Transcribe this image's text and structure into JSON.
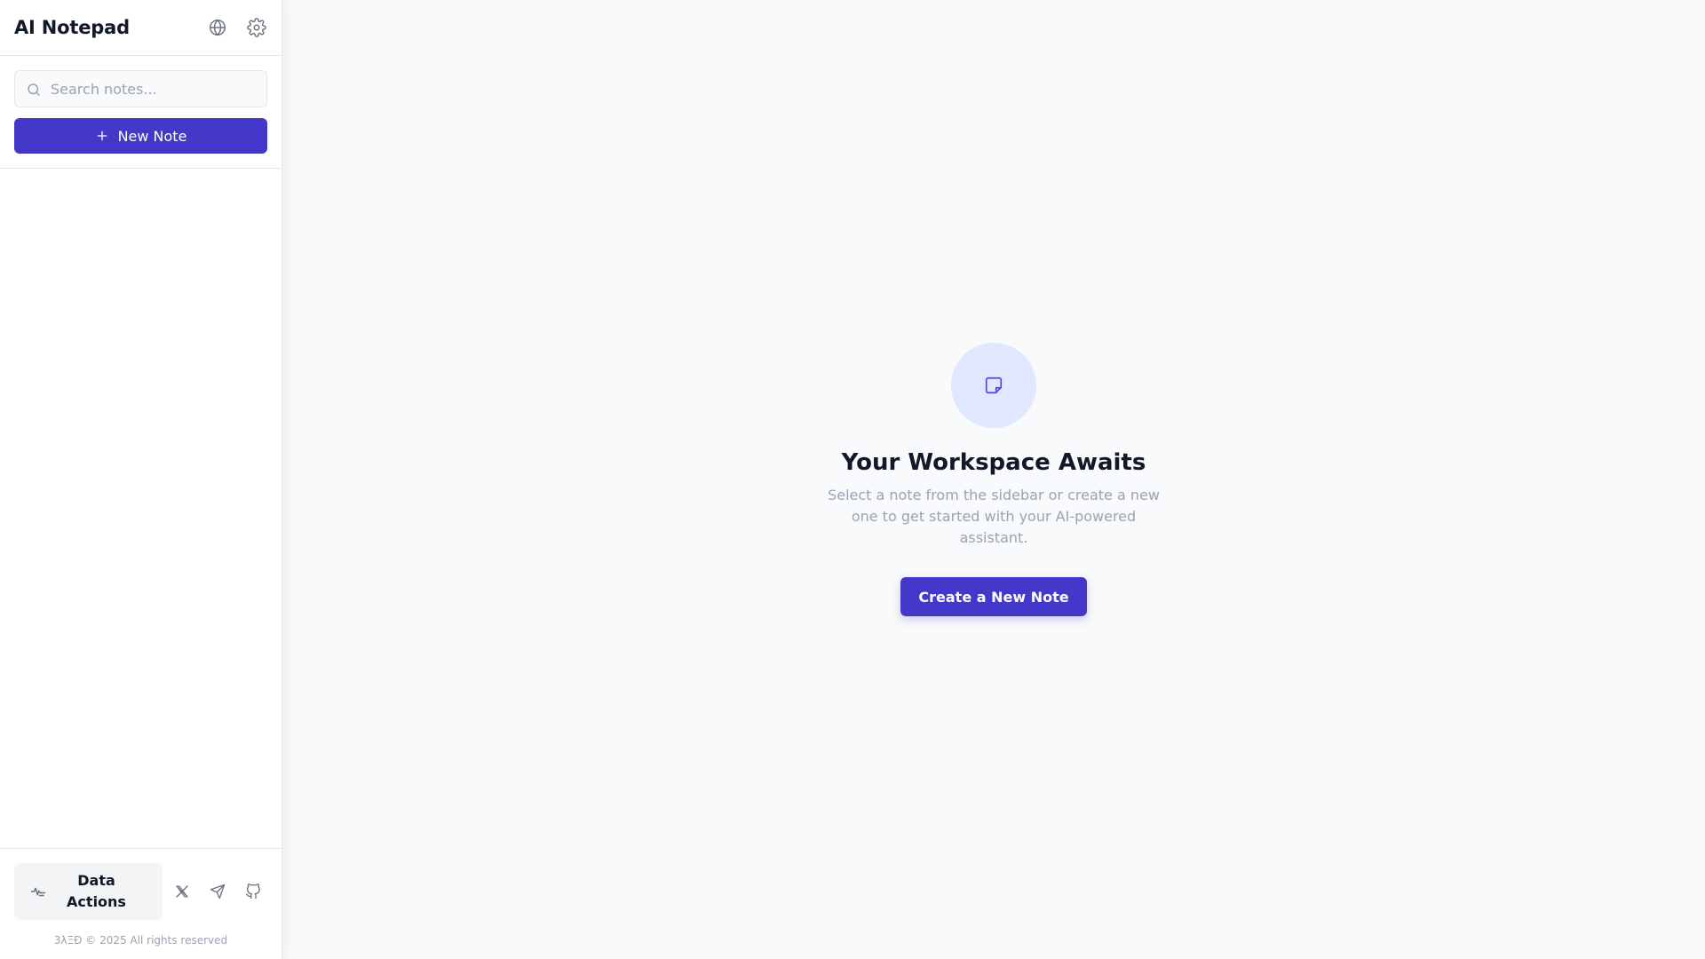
{
  "sidebar": {
    "title": "AI Notepad",
    "header_icons": [
      "globe-icon",
      "gear-icon"
    ],
    "search": {
      "placeholder": "Search notes...",
      "value": ""
    },
    "new_note_label": "New Note",
    "notes": [],
    "footer": {
      "data_actions_label": "Data Actions",
      "social_icons": [
        "x-icon",
        "telegram-icon",
        "github-icon"
      ],
      "copyright": "3λΞÐ © 2025 All rights reserved"
    }
  },
  "main": {
    "empty_state": {
      "icon": "sticky-note-icon",
      "title": "Your Workspace Awaits",
      "description": "Select a note from the sidebar or create a new one to get started with your AI-powered assistant.",
      "button_label": "Create a New Note"
    }
  },
  "colors": {
    "accent": "#4338ca",
    "accent_light": "#e0e7ff",
    "text_primary": "#111827",
    "text_muted": "#9ca3af",
    "border": "#e5e7eb",
    "background": "#f9fafb"
  }
}
